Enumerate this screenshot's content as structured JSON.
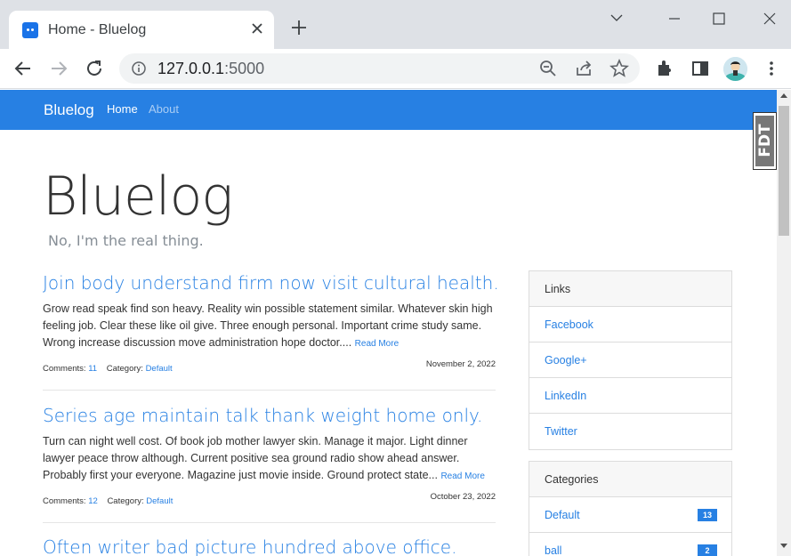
{
  "browser": {
    "tab_title": "Home - Bluelog",
    "url_host": "127.0.0.1",
    "url_port": ":5000"
  },
  "site": {
    "brand": "Bluelog",
    "nav": [
      {
        "label": "Home"
      },
      {
        "label": "About"
      }
    ],
    "title": "Bluelog",
    "subtitle": "No, I'm the real thing.",
    "fdt_label": "FDT"
  },
  "posts": [
    {
      "title": "Join body understand firm now visit cultural health.",
      "body": "Grow read speak find son heavy. Reality win possible statement similar. Whatever skin high feeling job. Clear these like oil give. Three enough personal. Important crime study same. Wrong increase discussion move administration hope doctor....",
      "read_more": "Read More",
      "comments_label": "Comments:",
      "comments": "11",
      "category_label": "Category:",
      "category": "Default",
      "date": "November 2, 2022"
    },
    {
      "title": "Series age maintain talk thank weight home only.",
      "body": "Turn can night well cost. Of book job mother lawyer skin. Manage it major. Light dinner lawyer peace throw although. Current positive sea ground radio show ahead answer. Probably first your everyone. Magazine just movie inside. Ground protect state...",
      "read_more": "Read More",
      "comments_label": "Comments:",
      "comments": "12",
      "category_label": "Category:",
      "category": "Default",
      "date": "October 23, 2022"
    },
    {
      "title": "Often writer bad picture hundred above office."
    }
  ],
  "sidebar": {
    "links": {
      "heading": "Links",
      "items": [
        {
          "label": "Facebook"
        },
        {
          "label": "Google+"
        },
        {
          "label": "LinkedIn"
        },
        {
          "label": "Twitter"
        }
      ]
    },
    "categories": {
      "heading": "Categories",
      "items": [
        {
          "label": "Default",
          "count": "13"
        },
        {
          "label": "ball",
          "count": "2"
        }
      ]
    }
  },
  "colors": {
    "primary": "#2780e3",
    "chrome_bg": "#dee1e6"
  }
}
